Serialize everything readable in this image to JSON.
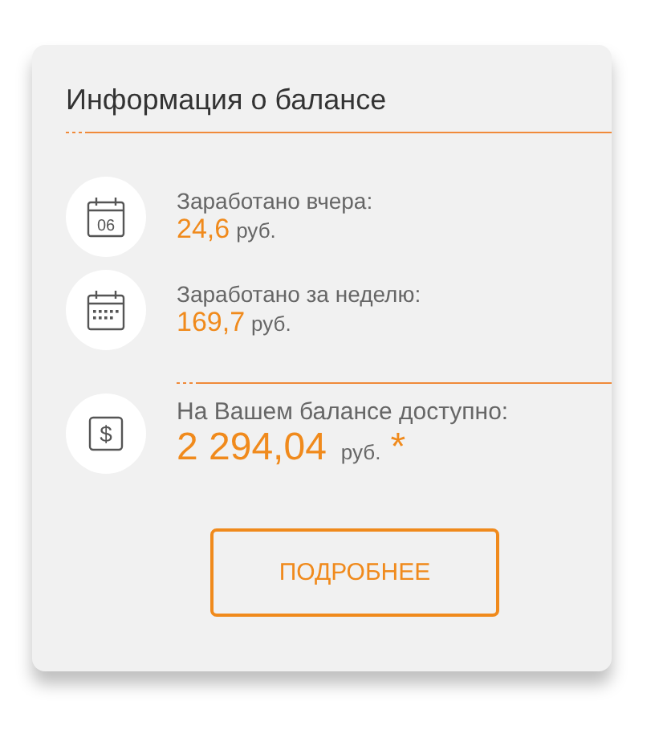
{
  "card": {
    "title": "Информация о балансе",
    "earnings": [
      {
        "kind": "date",
        "icon_text": "06",
        "label": "Заработано вчера:",
        "amount": "24,6",
        "currency": "руб."
      },
      {
        "kind": "week",
        "label": "Заработано за неделю:",
        "amount": "169,7",
        "currency": "руб."
      }
    ],
    "balance": {
      "icon_text": "$",
      "label": "На Вашем балансе доступно:",
      "amount": "2 294,04",
      "currency": "руб.",
      "footnote": "*"
    },
    "button": "ПОДРОБНЕЕ"
  }
}
